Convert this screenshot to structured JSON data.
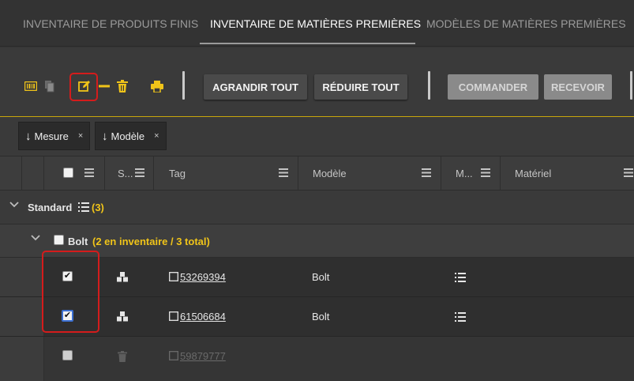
{
  "tabs": [
    {
      "label": "INVENTAIRE DE PRODUITS FINIS",
      "active": false
    },
    {
      "label": "INVENTAIRE DE MATIÈRES PREMIÈRES",
      "active": true
    },
    {
      "label": "MODÈLES DE MATIÈRES PREMIÈRES",
      "active": false
    }
  ],
  "toolbar": {
    "expand_all": "AGRANDIR TOUT",
    "collapse_all": "RÉDUIRE TOUT",
    "order": "COMMANDER",
    "receive": "RECEVOIR",
    "icon_color": "#f0c419"
  },
  "group_chips": [
    {
      "arrow": "↓",
      "label": "Mesure",
      "remove": "×"
    },
    {
      "arrow": "↓",
      "label": "Modèle",
      "remove": "×"
    }
  ],
  "columns": {
    "status": "S...",
    "tag": "Tag",
    "model": "Modèle",
    "m": "M...",
    "material": "Matériel"
  },
  "groups": {
    "standard": {
      "label": "Standard",
      "count": "(3)"
    },
    "bolt": {
      "label": "Bolt",
      "summary": "(2 en inventaire / 3 total)"
    }
  },
  "rows": [
    {
      "tag": "53269394",
      "model": "Bolt",
      "checked": true
    },
    {
      "tag": "61506684",
      "model": "Bolt",
      "checked": true
    },
    {
      "tag": "59879777",
      "model": "",
      "checked": false
    }
  ]
}
